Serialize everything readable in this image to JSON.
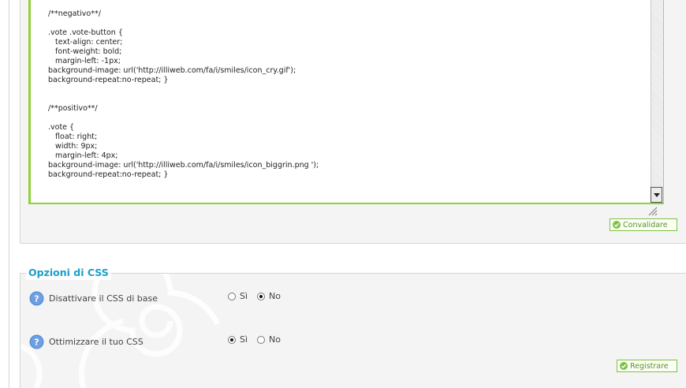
{
  "code_editor": {
    "content": "/**negativo**/\n\n.vote .vote-button {\n   text-align: center;\n   font-weight: bold;\n   margin-left: -1px;\nbackground-image: url('http://illiweb.com/fa/i/smiles/icon_cry.gif');\nbackground-repeat:no-repeat; }\n\n\n/**positivo**/\n\n.vote {\n   float: right;\n   width: 9px;\n   margin-left: 4px;\nbackground-image: url('http://illiweb.com/fa/i/smiles/icon_biggrin.png ');\nbackground-repeat:no-repeat; }"
  },
  "validate_button": {
    "label": "Convalidare"
  },
  "css_options": {
    "title": "Opzioni di CSS",
    "options": [
      {
        "label": "Disattivare il CSS di base",
        "yes": "Sì",
        "no": "No",
        "selected": "no"
      },
      {
        "label": "Ottimizzare il tuo CSS",
        "yes": "Sì",
        "no": "No",
        "selected": "yes"
      }
    ]
  },
  "register_button": {
    "label": "Registrare"
  },
  "colors": {
    "accent_green": "#8fd13a",
    "title_blue": "#1a9ec9",
    "help_icon_blue": "#5b8fd6"
  },
  "icons": [
    "check-circle-icon",
    "help-icon",
    "resize-grip-icon",
    "scroll-down-arrow-icon"
  ]
}
